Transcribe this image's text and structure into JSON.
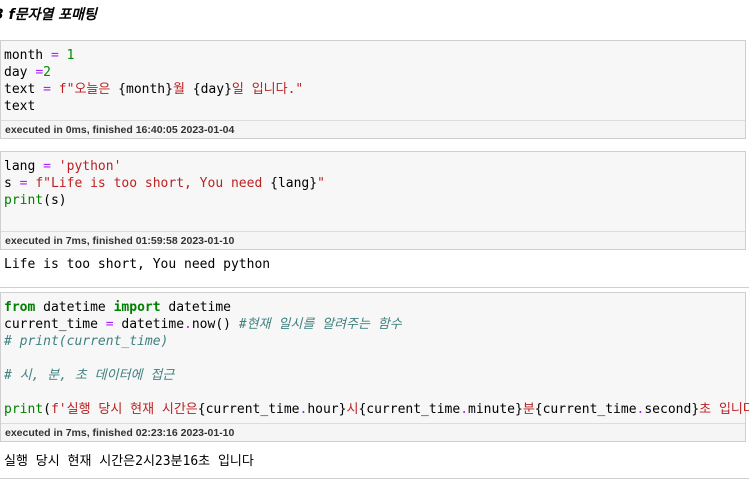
{
  "heading": {
    "number": "3",
    "text": "f문자열 포매팅"
  },
  "cells": [
    {
      "lines": [
        [
          [
            "month ",
            ""
          ],
          [
            "=",
            "op"
          ],
          [
            " ",
            ""
          ],
          [
            "1",
            "num"
          ]
        ],
        [
          [
            "day ",
            ""
          ],
          [
            "=",
            "op"
          ],
          [
            "2",
            "num"
          ]
        ],
        [
          [
            "text ",
            ""
          ],
          [
            "=",
            "op"
          ],
          [
            " ",
            ""
          ],
          [
            "f\"오늘은 ",
            "str"
          ],
          [
            "{month}",
            ""
          ],
          [
            "월 ",
            "str"
          ],
          [
            "{day}",
            ""
          ],
          [
            "일 입니다.\"",
            "str"
          ]
        ],
        [
          [
            "text",
            ""
          ]
        ]
      ],
      "exec": "executed in 0ms, finished 16:40:05 2023-01-04",
      "output": ""
    },
    {
      "lines": [
        [
          [
            "lang ",
            ""
          ],
          [
            "=",
            "op"
          ],
          [
            " ",
            ""
          ],
          [
            "'python'",
            "str"
          ]
        ],
        [
          [
            "s ",
            ""
          ],
          [
            "=",
            "op"
          ],
          [
            " ",
            ""
          ],
          [
            "f\"Life is too short, You need ",
            "str"
          ],
          [
            "{lang}",
            ""
          ],
          [
            "\"",
            "str"
          ]
        ],
        [
          [
            "print",
            "bi"
          ],
          [
            "(s)",
            ""
          ]
        ]
      ],
      "exec": "executed in 7ms, finished 01:59:58 2023-01-10",
      "output": "Life is too short, You need python"
    },
    {
      "lines": [
        [
          [
            "from",
            "kw"
          ],
          [
            " datetime ",
            ""
          ],
          [
            "import",
            "kw"
          ],
          [
            " datetime",
            ""
          ]
        ],
        [
          [
            "current_time ",
            ""
          ],
          [
            "=",
            "op"
          ],
          [
            " datetime",
            ""
          ],
          [
            ".",
            "op"
          ],
          [
            "now() ",
            ""
          ],
          [
            "#현재 일시를 알려주는 함수",
            "cm"
          ]
        ],
        [
          [
            "# print(current_time)",
            "cm"
          ]
        ],
        [
          [
            "",
            ""
          ]
        ],
        [
          [
            "# 시, 분, 초 데이터에 접근",
            "cm"
          ]
        ],
        [
          [
            "",
            ""
          ]
        ],
        [
          [
            "print",
            "bi"
          ],
          [
            "(",
            ""
          ],
          [
            "f'실행 당시 현재 시간은",
            "str"
          ],
          [
            "{current_time",
            ""
          ],
          [
            ".",
            "op"
          ],
          [
            "hour}",
            ""
          ],
          [
            "시",
            "str"
          ],
          [
            "{current_time",
            ""
          ],
          [
            ".",
            "op"
          ],
          [
            "minute}",
            ""
          ],
          [
            "분",
            "str"
          ],
          [
            "{current_time",
            ""
          ],
          [
            ".",
            "op"
          ],
          [
            "second}",
            ""
          ],
          [
            "초 입니다'",
            "str"
          ],
          [
            ")",
            ""
          ]
        ]
      ],
      "exec": "executed in 7ms, finished 02:23:16 2023-01-10",
      "output": "실행 당시 현재 시간은2시23분16초 입니다"
    }
  ]
}
